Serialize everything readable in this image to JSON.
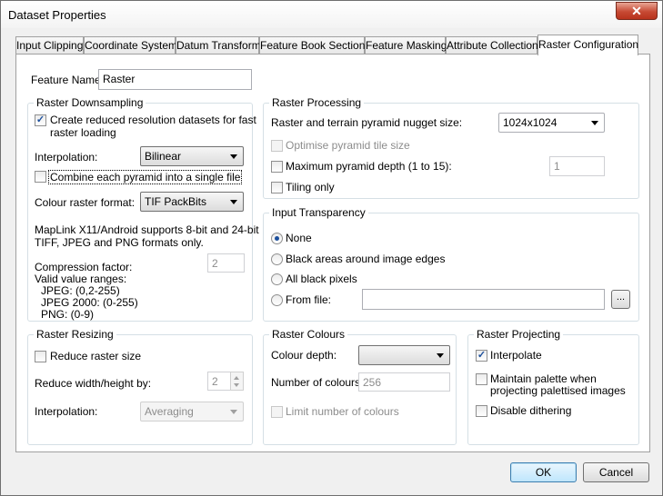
{
  "window": {
    "title": "Dataset Properties",
    "close_glyph": "✕"
  },
  "tabs": [
    {
      "label": "Input Clipping"
    },
    {
      "label": "Coordinate System"
    },
    {
      "label": "Datum Transform"
    },
    {
      "label": "Feature Book Section"
    },
    {
      "label": "Feature Masking"
    },
    {
      "label": "Attribute Collection"
    },
    {
      "label": "Raster Configuration"
    }
  ],
  "feature_name": {
    "label": "Feature Name",
    "value": "Raster"
  },
  "raster_downsampling": {
    "title": "Raster Downsampling",
    "create_reduced_line1": "Create reduced resolution datasets for fast",
    "create_reduced_line2": "raster loading",
    "create_reduced_checked": true,
    "interpolation_label": "Interpolation:",
    "interpolation_value": "Bilinear",
    "combine_label": "Combine each pyramid into a single file",
    "combine_checked": false,
    "colour_format_label": "Colour raster format:",
    "colour_format_value": "TIF PackBits",
    "support_line1": "MapLink X11/Android supports 8-bit and 24-bit",
    "support_line2": "TIFF, JPEG and PNG formats only.",
    "compression_label": "Compression factor:",
    "compression_value": "2",
    "valid_ranges_label": "Valid value ranges:",
    "range_jpeg": "JPEG: (0,2-255)",
    "range_jpeg2000": "JPEG 2000: (0-255)",
    "range_png": "PNG: (0-9)"
  },
  "raster_processing": {
    "title": "Raster Processing",
    "nugget_label": "Raster and terrain pyramid nugget size:",
    "nugget_value": "1024x1024",
    "optimise_label": "Optimise pyramid tile size",
    "max_depth_label": "Maximum pyramid depth (1 to 15):",
    "max_depth_value": "1",
    "tiling_label": "Tiling only"
  },
  "input_transparency": {
    "title": "Input Transparency",
    "options": [
      "None",
      "Black areas around image edges",
      "All black pixels",
      "From file:"
    ],
    "selected": "None",
    "file_value": "",
    "browse_label": "..."
  },
  "raster_resizing": {
    "title": "Raster Resizing",
    "reduce_label": "Reduce raster size",
    "reduce_by_label": "Reduce width/height by:",
    "reduce_by_value": "2",
    "interpolation_label": "Interpolation:",
    "interpolation_value": "Averaging"
  },
  "raster_colours": {
    "title": "Raster Colours",
    "depth_label": "Colour depth:",
    "depth_value": "",
    "num_colours_label": "Number of colours:",
    "num_colours_value": "256",
    "limit_label": "Limit number of colours"
  },
  "raster_projecting": {
    "title": "Raster Projecting",
    "interpolate_label": "Interpolate",
    "interpolate_checked": true,
    "maintain_line1": "Maintain palette when",
    "maintain_line2": "projecting palettised images",
    "disable_dither_label": "Disable dithering"
  },
  "buttons": {
    "ok": "OK",
    "cancel": "Cancel"
  }
}
